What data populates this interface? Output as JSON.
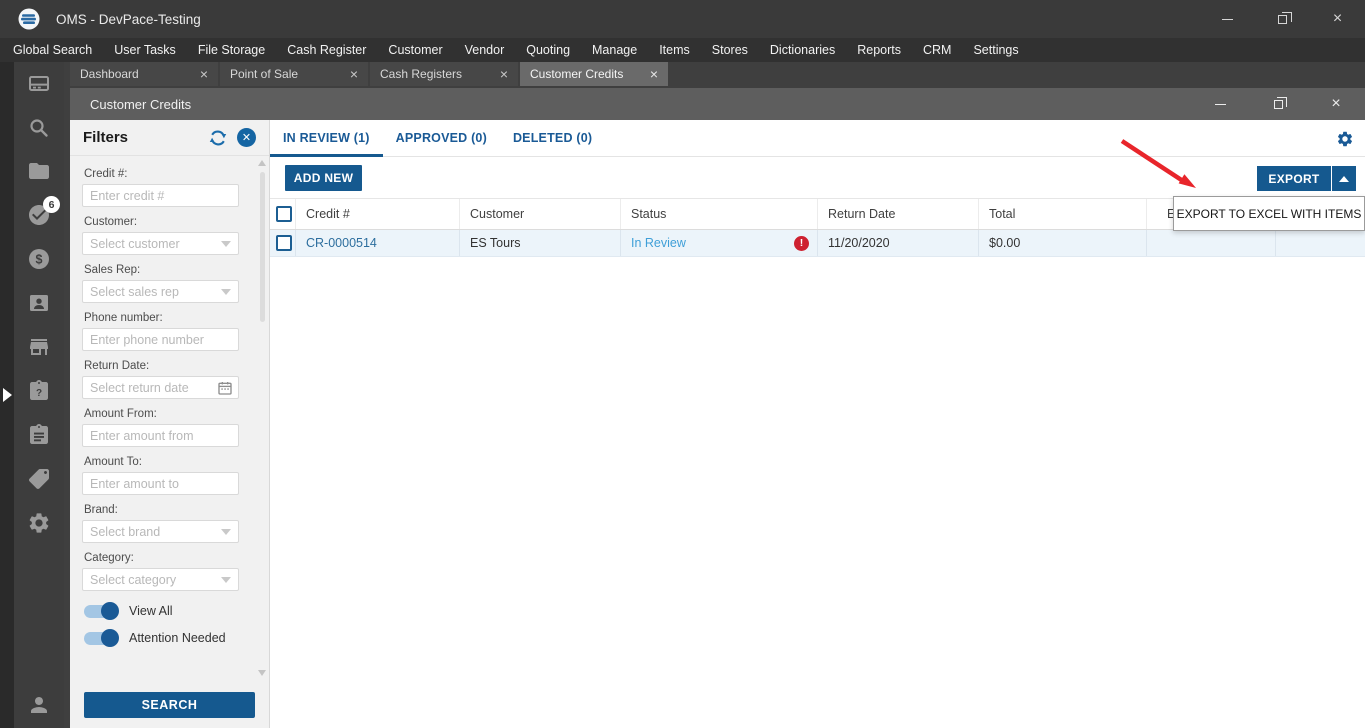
{
  "app": {
    "title": "OMS - DevPace-Testing",
    "menu_items": [
      "Global Search",
      "User Tasks",
      "File Storage",
      "Cash Register",
      "Customer",
      "Vendor",
      "Quoting",
      "Manage",
      "Items",
      "Stores",
      "Dictionaries",
      "Reports",
      "CRM",
      "Settings"
    ]
  },
  "workspace_tabs": {
    "labels": [
      "Dashboard",
      "Point of Sale",
      "Cash Registers",
      "Customer Credits"
    ],
    "active": "Customer Credits"
  },
  "panel": {
    "title": "Customer Credits"
  },
  "sidebar": {
    "task_badge": "6",
    "icons": [
      "dashboard",
      "search",
      "folder",
      "tasks-check",
      "money",
      "contact-card",
      "store",
      "help-clipboard",
      "clipboard",
      "tag",
      "settings",
      "user"
    ]
  },
  "filters": {
    "title": "Filters",
    "fields": [
      {
        "label": "Credit #:",
        "placeholder": "Enter credit #"
      },
      {
        "label": "Customer:",
        "placeholder": "Select customer"
      },
      {
        "label": "Sales Rep:",
        "placeholder": "Select sales rep"
      },
      {
        "label": "Phone number:",
        "placeholder": "Enter phone number"
      },
      {
        "label": "Return Date:",
        "placeholder": "Select return date"
      },
      {
        "label": "Amount From:",
        "placeholder": "Enter amount from"
      },
      {
        "label": "Amount To:",
        "placeholder": "Enter amount to"
      },
      {
        "label": "Brand:",
        "placeholder": "Select brand"
      },
      {
        "label": "Category:",
        "placeholder": "Select category"
      }
    ],
    "toggles": [
      {
        "label": "View All",
        "on": true
      },
      {
        "label": "Attention Needed",
        "on": true
      }
    ],
    "search_button": "SEARCH"
  },
  "view_tabs": {
    "labels": [
      "IN REVIEW (1)",
      "APPROVED (0)",
      "DELETED (0)"
    ],
    "active": "IN REVIEW (1)"
  },
  "toolbar": {
    "add_new_button": "ADD NEW",
    "export_button": "EXPORT"
  },
  "export_menu": {
    "items": [
      "EXPORT TO EXCEL WITH ITEMS"
    ]
  },
  "table": {
    "headers": {
      "credit_number": "Credit #",
      "customer": "Customer",
      "status": "Status",
      "return_date": "Return Date",
      "total": "Total",
      "partially_hidden": "E"
    },
    "rows": [
      {
        "credit_number": "CR-0000514",
        "customer": "ES Tours",
        "status": "In Review",
        "attention": "!",
        "return_date": "11/20/2020",
        "total": "$0.00"
      }
    ]
  },
  "colors": {
    "accent_blue": "#15598f",
    "link_blue": "#2d6e9e",
    "status_blue": "#3f9fd8",
    "alert_red": "#ce2130",
    "annotation_red": "#e8252b"
  }
}
